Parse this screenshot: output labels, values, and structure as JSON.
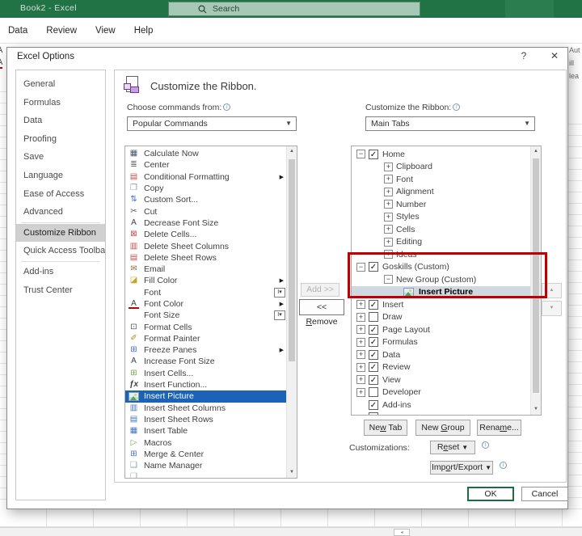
{
  "colors": {
    "titlebar_green": "#217346",
    "selection_blue": "#1c63b8",
    "annotation_red": "#c00000",
    "sidebar_selected_bg": "#d0d0d0",
    "tree_selected_bg": "#d2d8e0",
    "ok_border_green": "#1e6b43"
  },
  "title_bar": {
    "app_title": "Book2  -  Excel",
    "search_label": "Search"
  },
  "menu_bar": {
    "items": [
      "Data",
      "Review",
      "View",
      "Help"
    ]
  },
  "background": {
    "right_fragments": [
      "Aut",
      "ill",
      "lea"
    ],
    "left_fragment_top": "A",
    "left_fragment_bottom": "A",
    "bottom_scrollbox_glyph": "◂"
  },
  "dialog": {
    "title": "Excel Options",
    "help_button": "?",
    "close_button": "✕",
    "sidebar": {
      "items": [
        "General",
        "Formulas",
        "Data",
        "Proofing",
        "Save",
        "Language",
        "Ease of Access",
        "Advanced",
        "Customize Ribbon",
        "Quick Access Toolbar",
        "Add-ins",
        "Trust Center"
      ],
      "selected_index": 8,
      "separators_after": [
        7,
        9
      ]
    },
    "main": {
      "header_title": "Customize the Ribbon.",
      "choose_commands_label": "Choose commands from:",
      "choose_commands_value": "Popular Commands",
      "customize_label": "Customize the Ribbon:",
      "customize_value": "Main Tabs",
      "commands_list": {
        "items": [
          {
            "label": "Calculate Now",
            "icon": "calculator-icon",
            "glyph": "▦",
            "color": "#44546a"
          },
          {
            "label": "Center",
            "icon": "align-center-icon",
            "glyph": "≣",
            "color": "#6a6a6a"
          },
          {
            "label": "Conditional Formatting",
            "icon": "conditional-formatting-icon",
            "glyph": "▤",
            "color": "#c0504d",
            "trailing": "arrow"
          },
          {
            "label": "Copy",
            "icon": "copy-icon",
            "glyph": "❐",
            "color": "#8496b0"
          },
          {
            "label": "Custom Sort...",
            "icon": "sort-icon",
            "glyph": "⇅",
            "color": "#4472c4"
          },
          {
            "label": "Cut",
            "icon": "scissors-icon",
            "glyph": "✂",
            "color": "#595959"
          },
          {
            "label": "Decrease Font Size",
            "icon": "decrease-font-size-icon",
            "glyph": "A",
            "color": "#404040"
          },
          {
            "label": "Delete Cells...",
            "icon": "delete-cells-icon",
            "glyph": "⊠",
            "color": "#c0504d"
          },
          {
            "label": "Delete Sheet Columns",
            "icon": "delete-sheet-columns-icon",
            "glyph": "▥",
            "color": "#c0504d"
          },
          {
            "label": "Delete Sheet Rows",
            "icon": "delete-sheet-rows-icon",
            "glyph": "▤",
            "color": "#c0504d"
          },
          {
            "label": "Email",
            "icon": "email-icon",
            "glyph": "✉",
            "color": "#8a6d3b"
          },
          {
            "label": "Fill Color",
            "icon": "fill-color-icon",
            "glyph": "◪",
            "color": "#c9a227",
            "trailing": "arrow"
          },
          {
            "label": "Font",
            "icon": "",
            "glyph": "",
            "trailing": "combo"
          },
          {
            "label": "Font Color",
            "icon": "font-color-icon",
            "glyph": "A",
            "color": "#404040",
            "underline_red": true,
            "trailing": "arrow"
          },
          {
            "label": "Font Size",
            "icon": "",
            "glyph": "",
            "trailing": "combo"
          },
          {
            "label": "Format Cells",
            "icon": "format-cells-icon",
            "glyph": "⊡",
            "color": "#595959"
          },
          {
            "label": "Format Painter",
            "icon": "format-painter-icon",
            "glyph": "✐",
            "color": "#b8860b"
          },
          {
            "label": "Freeze Panes",
            "icon": "freeze-panes-icon",
            "glyph": "⊞",
            "color": "#4472c4",
            "trailing": "arrow"
          },
          {
            "label": "Increase Font Size",
            "icon": "increase-font-size-icon",
            "glyph": "A",
            "color": "#404040"
          },
          {
            "label": "Insert Cells...",
            "icon": "insert-cells-icon",
            "glyph": "⊞",
            "color": "#70ad47"
          },
          {
            "label": "Insert Function...",
            "icon": "insert-function-icon",
            "glyph": "ƒx",
            "color": "#404040",
            "italic": true
          },
          {
            "label": "Insert Picture",
            "icon": "insert-picture-icon",
            "glyph": "pic",
            "selected": true
          },
          {
            "label": "Insert Sheet Columns",
            "icon": "insert-sheet-columns-icon",
            "glyph": "▥",
            "color": "#4472c4"
          },
          {
            "label": "Insert Sheet Rows",
            "icon": "insert-sheet-rows-icon",
            "glyph": "▤",
            "color": "#4472c4"
          },
          {
            "label": "Insert Table",
            "icon": "insert-table-icon",
            "glyph": "▦",
            "color": "#4472c4"
          },
          {
            "label": "Macros",
            "icon": "macros-icon",
            "glyph": "▷",
            "color": "#70ad47"
          },
          {
            "label": "Merge & Center",
            "icon": "merge-center-icon",
            "glyph": "⊞",
            "color": "#4472c4"
          },
          {
            "label": "Name Manager",
            "icon": "name-manager-icon",
            "glyph": "❏",
            "color": "#8496b0"
          },
          {
            "label": "",
            "icon": "clipped-item-icon",
            "glyph": "❏",
            "color": "#9a9a9a",
            "partial": true
          }
        ]
      },
      "ribbon_tree": {
        "items": [
          {
            "label": "Home",
            "level": 0,
            "expand": "minus",
            "checked": true
          },
          {
            "label": "Clipboard",
            "level": 1,
            "expand": "plus"
          },
          {
            "label": "Font",
            "level": 1,
            "expand": "plus"
          },
          {
            "label": "Alignment",
            "level": 1,
            "expand": "plus"
          },
          {
            "label": "Number",
            "level": 1,
            "expand": "plus"
          },
          {
            "label": "Styles",
            "level": 1,
            "expand": "plus"
          },
          {
            "label": "Cells",
            "level": 1,
            "expand": "plus"
          },
          {
            "label": "Editing",
            "level": 1,
            "expand": "plus"
          },
          {
            "label": "Ideas",
            "level": 1,
            "expand": "plus"
          },
          {
            "label": "Goskills (Custom)",
            "level": 0,
            "expand": "minus",
            "checked": true
          },
          {
            "label": "New Group (Custom)",
            "level": 1,
            "expand": "minus"
          },
          {
            "label": "Insert Picture",
            "level": 2,
            "icon": "insert-picture-icon",
            "selected": true
          },
          {
            "label": "Insert",
            "level": 0,
            "expand": "plus",
            "checked": true
          },
          {
            "label": "Draw",
            "level": 0,
            "expand": "plus",
            "checked": false
          },
          {
            "label": "Page Layout",
            "level": 0,
            "expand": "plus",
            "checked": true
          },
          {
            "label": "Formulas",
            "level": 0,
            "expand": "plus",
            "checked": true
          },
          {
            "label": "Data",
            "level": 0,
            "expand": "plus",
            "checked": true
          },
          {
            "label": "Review",
            "level": 0,
            "expand": "plus",
            "checked": true
          },
          {
            "label": "View",
            "level": 0,
            "expand": "plus",
            "checked": true
          },
          {
            "label": "Developer",
            "level": 0,
            "expand": "plus",
            "checked": false
          },
          {
            "label": "Add-ins",
            "level": 0,
            "expand": "none",
            "checked": true
          },
          {
            "label": "",
            "level": 0,
            "expand": "none",
            "checked": false,
            "partial": true
          }
        ]
      },
      "middle_buttons": {
        "add_label": "Add >>",
        "remove_label": "<< Remove",
        "remove_underline_index": 3
      },
      "move_buttons": {
        "up_glyph": "▲",
        "down_glyph": "▼"
      },
      "tab_buttons": [
        {
          "label": "New Tab",
          "underline_index": 2
        },
        {
          "label": "New Group",
          "underline_index": 4
        },
        {
          "label": "Rename...",
          "underline_index": 4
        }
      ],
      "customizations": {
        "label": "Customizations:",
        "reset_label": "Reset",
        "reset_underline_index": 1,
        "import_export_label": "Import/Export",
        "import_export_underline_index": 3
      }
    },
    "footer": {
      "ok_label": "OK",
      "cancel_label": "Cancel"
    }
  }
}
